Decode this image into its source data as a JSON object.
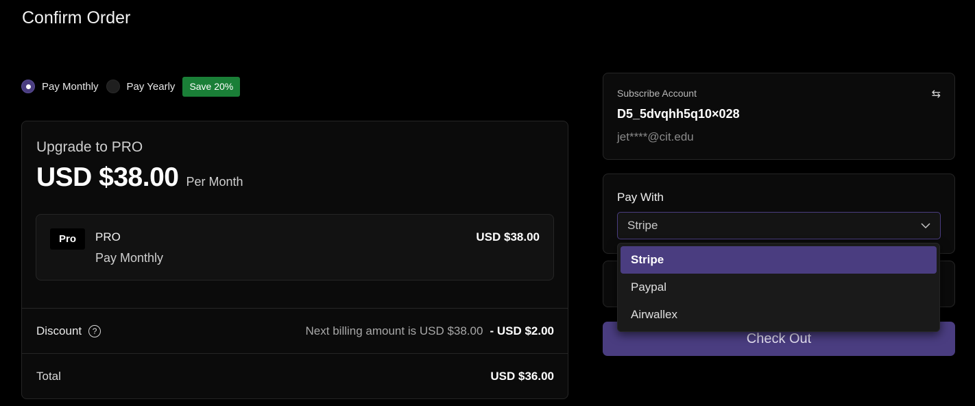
{
  "page": {
    "title": "Confirm Order"
  },
  "billing": {
    "options": [
      {
        "label": "Pay Monthly",
        "checked": true
      },
      {
        "label": "Pay Yearly",
        "checked": false
      }
    ],
    "save_badge": "Save 20%"
  },
  "order": {
    "plan_heading": "Upgrade to PRO",
    "price": "USD $38.00",
    "period": "Per Month",
    "item": {
      "badge": "Pro",
      "name": "PRO",
      "cycle": "Pay Monthly",
      "price": "USD $38.00"
    },
    "discount": {
      "label": "Discount",
      "help_icon": "?",
      "next_billing": "Next billing amount is USD $38.00",
      "amount": "- USD $2.00"
    },
    "total": {
      "label": "Total",
      "amount": "USD $36.00"
    }
  },
  "account": {
    "title": "Subscribe Account",
    "swap_icon": "⇆",
    "id": "D5_5dvqhh5q10×028",
    "email": "jet****@cit.edu"
  },
  "pay_with": {
    "title": "Pay With",
    "selected": "Stripe",
    "options": [
      "Stripe",
      "Paypal",
      "Airwallex"
    ]
  },
  "checkout": {
    "label": "Check Out"
  },
  "colors": {
    "accent": "#4a3d80",
    "save_green": "#1a7f37",
    "background": "#000000",
    "card": "#0b0b0b"
  }
}
